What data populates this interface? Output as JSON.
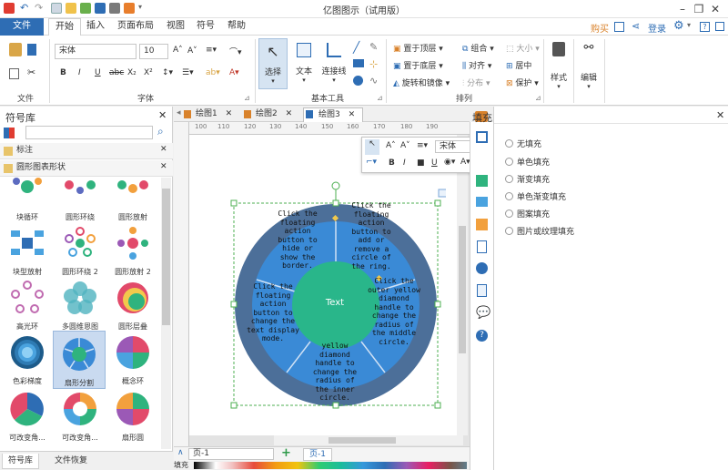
{
  "app": {
    "title": "亿图图示（试用版）"
  },
  "menu_tabs": [
    "文件",
    "开始",
    "插入",
    "页面布局",
    "视图",
    "符号",
    "帮助"
  ],
  "top_right": {
    "buy": "购买",
    "login": "登录"
  },
  "ribbon": {
    "groups": {
      "file": "文件",
      "font": "字体",
      "basic_tools": "基本工具",
      "arrange": "排列"
    },
    "font_name": "宋体",
    "font_size": "10",
    "tools": {
      "select": "选择",
      "text": "文本",
      "connector": "连接线"
    },
    "arrange": {
      "top": "置于顶层",
      "bottom": "置于底层",
      "rotate": "旋转和镜像",
      "group": "组合",
      "align": "对齐",
      "distribute": "分布",
      "size": "大小",
      "center": "居中",
      "protect": "保护"
    },
    "style": "样式",
    "edit": "编辑",
    "text_styles": [
      "B",
      "I",
      "U",
      "abc",
      "X₂",
      "X²"
    ]
  },
  "left_panel": {
    "title": "符号库",
    "categories": [
      "标注",
      "圆形图表形状"
    ],
    "shapes": [
      "块循环",
      "圆形环绕",
      "圆形放射",
      "块型放射",
      "圆形环绕 2",
      "圆形放射 2",
      "高光环",
      "多圆维恩图",
      "圆形层叠",
      "色彩梯度",
      "扇形分割",
      "概念环",
      "可改变角...",
      "可改变角...",
      "扇形圆"
    ],
    "bottom_tabs": [
      "符号库",
      "文件恢复"
    ]
  },
  "doc_tabs": [
    "绘图1",
    "绘图2",
    "绘图3"
  ],
  "ruler_labels": [
    "100",
    "110",
    "120",
    "130",
    "140",
    "150",
    "160",
    "170",
    "180",
    "190"
  ],
  "diagram": {
    "center": "Text",
    "texts": [
      "Click the floating action button to hide or show the border.",
      "Click the floating action button to add or remove a circle of the ring.",
      "Click the outer yellow diamond handle to change the radius of the middle circle.",
      "yellow diamond handle to change the radius of the inner circle.",
      "Click the floating action button to change the text display mode."
    ],
    "colors": {
      "outer": "#4c6f99",
      "mid": "#3a8ad6",
      "center": "#29b68a",
      "sep": "#cfe1f5"
    }
  },
  "floatbar": {
    "font": "宋体"
  },
  "page_bar": {
    "page_select": "页-1",
    "page_tab": "页-1",
    "fill_label": "填充"
  },
  "right_panel": {
    "title": "填充",
    "options": [
      "无填充",
      "单色填充",
      "渐变填充",
      "单色渐变填充",
      "图案填充",
      "图片或纹理填充"
    ]
  }
}
